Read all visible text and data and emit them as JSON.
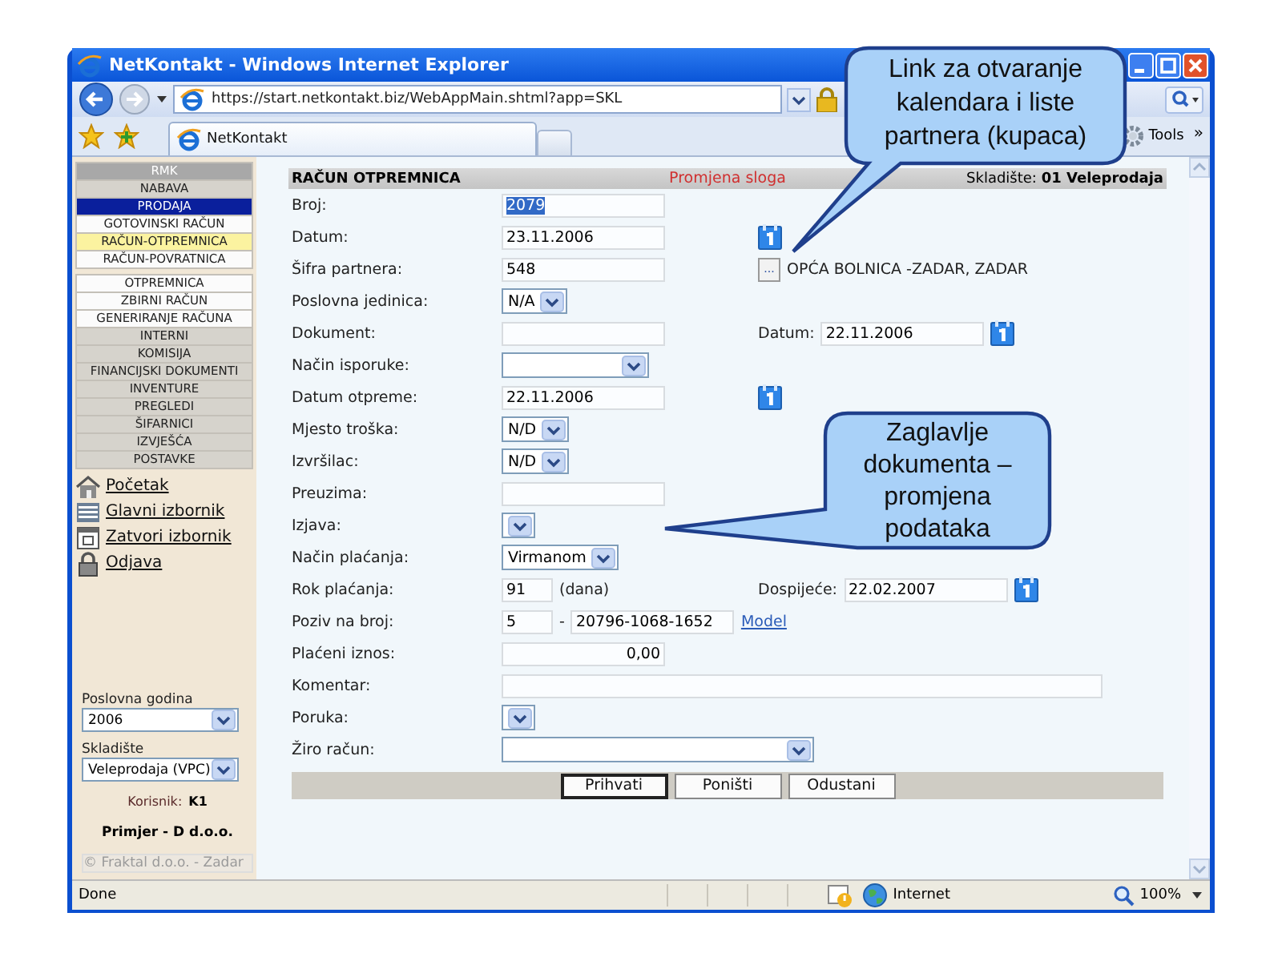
{
  "window": {
    "title": "NetKontakt - Windows Internet Explorer",
    "address": "https://start.netkontakt.biz/WebAppMain.shtml?app=SKL",
    "tab": "NetKontakt",
    "tools": "Tools",
    "overflow": "»"
  },
  "sidebar": {
    "header": "RMK",
    "items": [
      {
        "label": "NABAVA",
        "kind": "group",
        "selected": false
      },
      {
        "label": "PRODAJA",
        "kind": "group",
        "selected": true
      },
      {
        "label": "GOTOVINSKI RAČUN",
        "kind": "sub",
        "selected": false
      },
      {
        "label": "RAČUN-OTPREMNICA",
        "kind": "sub",
        "selected": true
      },
      {
        "label": "RAČUN-POVRATNICA",
        "kind": "sub",
        "selected": false
      },
      {
        "label": "OTPREMNICA",
        "kind": "sub-start",
        "selected": false
      },
      {
        "label": "ZBIRNI RAČUN",
        "kind": "sub",
        "selected": false
      },
      {
        "label": "GENERIRANJE RAČUNA",
        "kind": "sub",
        "selected": false
      },
      {
        "label": "INTERNI",
        "kind": "group",
        "selected": false
      },
      {
        "label": "KOMISIJA",
        "kind": "group",
        "selected": false
      },
      {
        "label": "FINANCIJSKI DOKUMENTI",
        "kind": "group",
        "selected": false
      },
      {
        "label": "INVENTURE",
        "kind": "group",
        "selected": false
      },
      {
        "label": "PREGLEDI",
        "kind": "group",
        "selected": false
      },
      {
        "label": "ŠIFARNICI",
        "kind": "group",
        "selected": false
      },
      {
        "label": "IZVJEŠĆA",
        "kind": "group",
        "selected": false
      },
      {
        "label": "POSTAVKE",
        "kind": "group",
        "selected": false
      }
    ],
    "links": [
      {
        "label": "Početak",
        "kind": "home"
      },
      {
        "label": "Glavni izbornik",
        "kind": "menu"
      },
      {
        "label": "Zatvori izbornik",
        "kind": "window"
      },
      {
        "label": "Odjava",
        "kind": "lock"
      }
    ],
    "year_label": "Poslovna godina",
    "year": "2006",
    "warehouse_label": "Skladište",
    "warehouse": "Veleprodaja (VPC)",
    "user_label": "Korisnik:",
    "user": "K1",
    "company": "Primjer - D d.o.o.",
    "copyright": "© Fraktal d.o.o. - Zadar"
  },
  "form": {
    "title": "RAČUN OTPREMNICA",
    "mode": "Promjena sloga",
    "warehouse": "Skladište: **01 Veleprodaja**",
    "rows": [
      {
        "label": "Broj:",
        "fields": [
          {
            "kind": "input",
            "value": "2079",
            "highlighted": true
          }
        ]
      },
      {
        "label": "Datum:",
        "fields": [
          {
            "kind": "input",
            "value": "23.11.2006",
            "highlighted": false
          }
        ],
        "extra": [
          {
            "kind": "calendar"
          }
        ]
      },
      {
        "label": "Šifra partnera:",
        "fields": [
          {
            "kind": "input",
            "value": "548",
            "highlighted": false
          }
        ],
        "extra": [
          {
            "kind": "browse",
            "value": "..."
          },
          {
            "kind": "note",
            "value": "OPĆA BOLNICA -ZADAR, ZADAR"
          }
        ]
      },
      {
        "label": "Poslovna jedinica:",
        "fields": [
          {
            "kind": "dropdown",
            "value": "N/A"
          }
        ]
      },
      {
        "label": "Dokument:",
        "fields": [
          {
            "kind": "input"
          }
        ],
        "extra": [
          {
            "kind": "note",
            "value": "Datum:"
          },
          {
            "kind": "input",
            "value": "22.11.2006",
            "highlighted": false
          },
          {
            "kind": "calendar"
          }
        ]
      },
      {
        "label": "Način isporuke:",
        "fields": [
          {
            "kind": "wide-dropdown"
          }
        ]
      },
      {
        "label": "Datum otpreme:",
        "fields": [
          {
            "kind": "input",
            "value": "22.11.2006",
            "highlighted": false
          }
        ],
        "extra": [
          {
            "kind": "calendar"
          }
        ]
      },
      {
        "label": "Mjesto troška:",
        "fields": [
          {
            "kind": "dropdown",
            "value": "N/D"
          }
        ]
      },
      {
        "label": "Izvršilac:",
        "fields": [
          {
            "kind": "dropdown",
            "value": "N/D"
          }
        ]
      },
      {
        "label": "Preuzima:",
        "fields": [
          {
            "kind": "input"
          }
        ]
      },
      {
        "label": "Izjava:",
        "fields": [
          {
            "kind": "dropdown"
          }
        ]
      },
      {
        "label": "Način plaćanja:",
        "fields": [
          {
            "kind": "dropdown",
            "value": "Virmanom"
          }
        ]
      },
      {
        "label": "Rok plaćanja:",
        "fields": [
          {
            "kind": "short-input",
            "value": "91"
          },
          {
            "kind": "note",
            "value": "(dana)"
          }
        ],
        "extra": [
          {
            "kind": "note",
            "value": "Dospijeće:"
          },
          {
            "kind": "input",
            "value": "22.02.2007",
            "highlighted": false
          },
          {
            "kind": "calendar"
          }
        ]
      },
      {
        "label": "Poziv na broj:",
        "fields": [
          {
            "kind": "short-input",
            "value": "5"
          },
          {
            "kind": "note",
            "value": "-"
          },
          {
            "kind": "input",
            "value": "20796-1068-1652",
            "highlighted": false
          },
          {
            "kind": "link",
            "value": "Model"
          }
        ]
      },
      {
        "label": "Plaćeni iznos:",
        "fields": [
          {
            "kind": "amount",
            "value": "0,00"
          }
        ]
      },
      {
        "label": "Komentar:",
        "fields": [
          {
            "kind": "long-input"
          }
        ]
      },
      {
        "label": "Poruka:",
        "fields": [
          {
            "kind": "dropdown"
          }
        ]
      },
      {
        "label": "Žiro račun:",
        "fields": [
          {
            "kind": "long-dropdown"
          }
        ]
      }
    ],
    "buttons": [
      {
        "label": "Prihvati",
        "default": true
      },
      {
        "label": "Poništi",
        "default": false
      },
      {
        "label": "Odustani",
        "default": false
      }
    ]
  },
  "callouts": [
    {
      "kind": "top",
      "text": "Link za otvaranje\nkalendara i liste\npartnera (kupaca)"
    },
    {
      "kind": "side",
      "text": "Zaglavlje\ndokumenta –\npromjena\npodataka"
    }
  ],
  "status_bar": {
    "text": "Done",
    "zone": "Internet",
    "zoom": "100%"
  }
}
